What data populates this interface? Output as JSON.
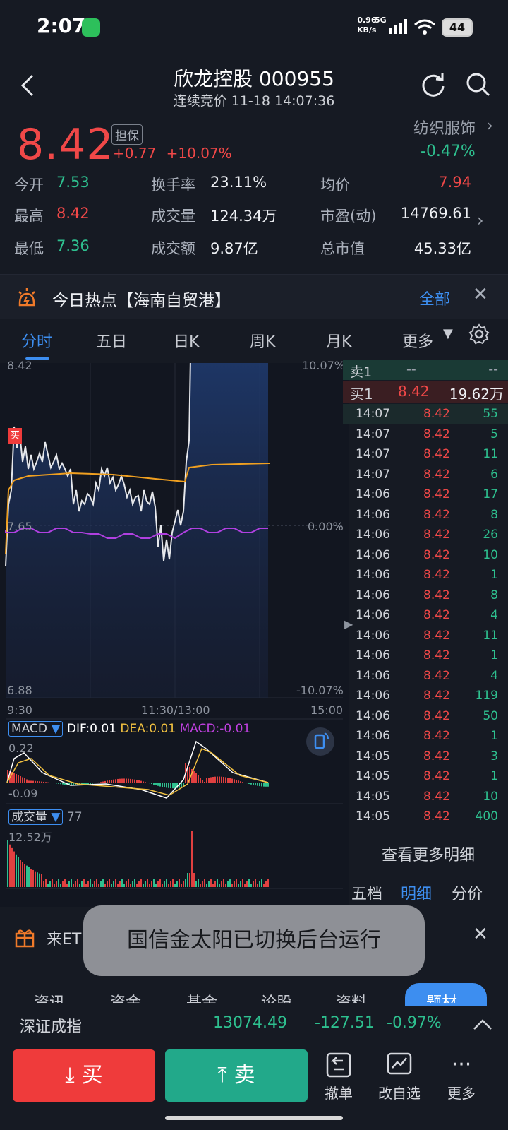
{
  "status": {
    "time": "2:07",
    "net_speed_value": "0.96",
    "net_speed_unit": "KB/s",
    "network": "5G",
    "battery": "44"
  },
  "header": {
    "title": "欣龙控股 000955",
    "subtitle": "连续竞价 11-18 14:07:36"
  },
  "quote": {
    "price": "8.42",
    "badge": "担保",
    "change": "+0.77",
    "change_pct": "+10.07%",
    "industry": "纺织服饰",
    "industry_change": "-0.47%",
    "stats": [
      {
        "label": "今开",
        "value": "7.53",
        "color": "#2ec08f"
      },
      {
        "label": "换手率",
        "value": "23.11%",
        "color": "#eef0f4"
      },
      {
        "label": "均价",
        "value": "7.94",
        "color": "#f04848"
      },
      {
        "label": "最高",
        "value": "8.42",
        "color": "#f04848"
      },
      {
        "label": "成交量",
        "value": "124.34万",
        "color": "#eef0f4"
      },
      {
        "label": "市盈(动)",
        "value": "14769.61",
        "color": "#eef0f4"
      },
      {
        "label": "最低",
        "value": "7.36",
        "color": "#2ec08f"
      },
      {
        "label": "成交额",
        "value": "9.87亿",
        "color": "#eef0f4"
      },
      {
        "label": "总市值",
        "value": "45.33亿",
        "color": "#eef0f4"
      }
    ]
  },
  "hot": {
    "text": "今日热点【海南自贸港】",
    "all_label": "全部"
  },
  "tabs": [
    "分时",
    "五日",
    "日K",
    "周K",
    "月K",
    "更多"
  ],
  "chart": {
    "y_top": "8.42",
    "y_bottom": "6.88",
    "y_mid": "7.65",
    "pct_top": "10.07%",
    "pct_mid": "0.00%",
    "pct_bottom": "-10.07%",
    "x_start": "9:30",
    "x_mid": "11:30/13:00",
    "x_end": "15:00",
    "buy_marker": "买",
    "macd_label": "MACD",
    "dif": "DIF:0.01",
    "dea": "DEA:0.01",
    "macd": "MACD:-0.01",
    "macd_top": "0.22",
    "macd_bottom": "-0.09",
    "vol_label": "成交量",
    "vol_value": "77",
    "vol_top": "12.52万"
  },
  "orderbook": {
    "sell1_label": "卖1",
    "sell1_price": "--",
    "sell1_vol": "--",
    "buy1_label": "买1",
    "buy1_price": "8.42",
    "buy1_vol": "19.62万"
  },
  "trades": [
    {
      "time": "14:07",
      "price": "8.42",
      "vol": "55"
    },
    {
      "time": "14:07",
      "price": "8.42",
      "vol": "5"
    },
    {
      "time": "14:07",
      "price": "8.42",
      "vol": "11"
    },
    {
      "time": "14:07",
      "price": "8.42",
      "vol": "6"
    },
    {
      "time": "14:06",
      "price": "8.42",
      "vol": "17"
    },
    {
      "time": "14:06",
      "price": "8.42",
      "vol": "8"
    },
    {
      "time": "14:06",
      "price": "8.42",
      "vol": "26"
    },
    {
      "time": "14:06",
      "price": "8.42",
      "vol": "10"
    },
    {
      "time": "14:06",
      "price": "8.42",
      "vol": "1"
    },
    {
      "time": "14:06",
      "price": "8.42",
      "vol": "8"
    },
    {
      "time": "14:06",
      "price": "8.42",
      "vol": "4"
    },
    {
      "time": "14:06",
      "price": "8.42",
      "vol": "11"
    },
    {
      "time": "14:06",
      "price": "8.42",
      "vol": "1"
    },
    {
      "time": "14:06",
      "price": "8.42",
      "vol": "4"
    },
    {
      "time": "14:06",
      "price": "8.42",
      "vol": "119"
    },
    {
      "time": "14:06",
      "price": "8.42",
      "vol": "50"
    },
    {
      "time": "14:06",
      "price": "8.42",
      "vol": "1"
    },
    {
      "time": "14:05",
      "price": "8.42",
      "vol": "3"
    },
    {
      "time": "14:05",
      "price": "8.42",
      "vol": "1"
    },
    {
      "time": "14:05",
      "price": "8.42",
      "vol": "10"
    },
    {
      "time": "14:05",
      "price": "8.42",
      "vol": "400"
    }
  ],
  "panel": {
    "more_detail": "查看更多明细",
    "subtabs": [
      "五档",
      "明细",
      "分价"
    ]
  },
  "promo": {
    "label": "来ET"
  },
  "toast": {
    "text": "国信金太阳已切换后台运行"
  },
  "bottom_tabs": [
    "资讯",
    "资金",
    "基金",
    "论股",
    "资料",
    "题材"
  ],
  "index": {
    "name": "深证成指",
    "value": "13074.49",
    "change": "-127.51",
    "pct": "-0.97%"
  },
  "actions": {
    "buy": "买",
    "sell": "卖",
    "cancel": "撤单",
    "watch": "改自选",
    "more": "更多"
  }
}
